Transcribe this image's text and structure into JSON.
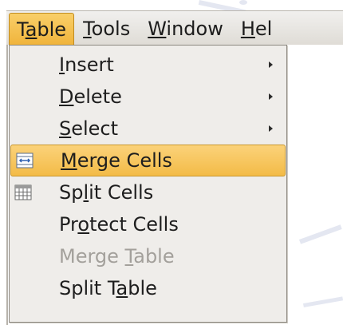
{
  "menubar": {
    "items": [
      {
        "pre": "T",
        "mnemonic": "a",
        "post": "ble",
        "active": true
      },
      {
        "pre": "",
        "mnemonic": "T",
        "post": "ools",
        "active": false
      },
      {
        "pre": "",
        "mnemonic": "W",
        "post": "indow",
        "active": false
      },
      {
        "pre": "",
        "mnemonic": "H",
        "post": "el",
        "active": false
      }
    ]
  },
  "table_menu": {
    "items": [
      {
        "pre": "",
        "mnemonic": "I",
        "post": "nsert",
        "icon": null,
        "submenu": true,
        "state": "normal"
      },
      {
        "pre": "",
        "mnemonic": "D",
        "post": "elete",
        "icon": null,
        "submenu": true,
        "state": "normal"
      },
      {
        "pre": "",
        "mnemonic": "S",
        "post": "elect",
        "icon": null,
        "submenu": true,
        "state": "normal"
      },
      {
        "pre": "",
        "mnemonic": "M",
        "post": "erge Cells",
        "icon": "merge-cells-icon",
        "submenu": false,
        "state": "highlighted"
      },
      {
        "pre": "Sp",
        "mnemonic": "l",
        "post": "it Cells",
        "icon": "split-cells-icon",
        "submenu": false,
        "state": "normal"
      },
      {
        "pre": "Pr",
        "mnemonic": "o",
        "post": "tect Cells",
        "icon": null,
        "submenu": false,
        "state": "normal"
      },
      {
        "pre": "Merge ",
        "mnemonic": "T",
        "post": "able",
        "icon": null,
        "submenu": false,
        "state": "disabled"
      },
      {
        "pre": "Split T",
        "mnemonic": "a",
        "post": "ble",
        "icon": null,
        "submenu": false,
        "state": "normal"
      }
    ]
  },
  "colors": {
    "highlight": "#f3bb47",
    "menu_background": "#efedea",
    "disabled_text": "#a3a09b"
  }
}
